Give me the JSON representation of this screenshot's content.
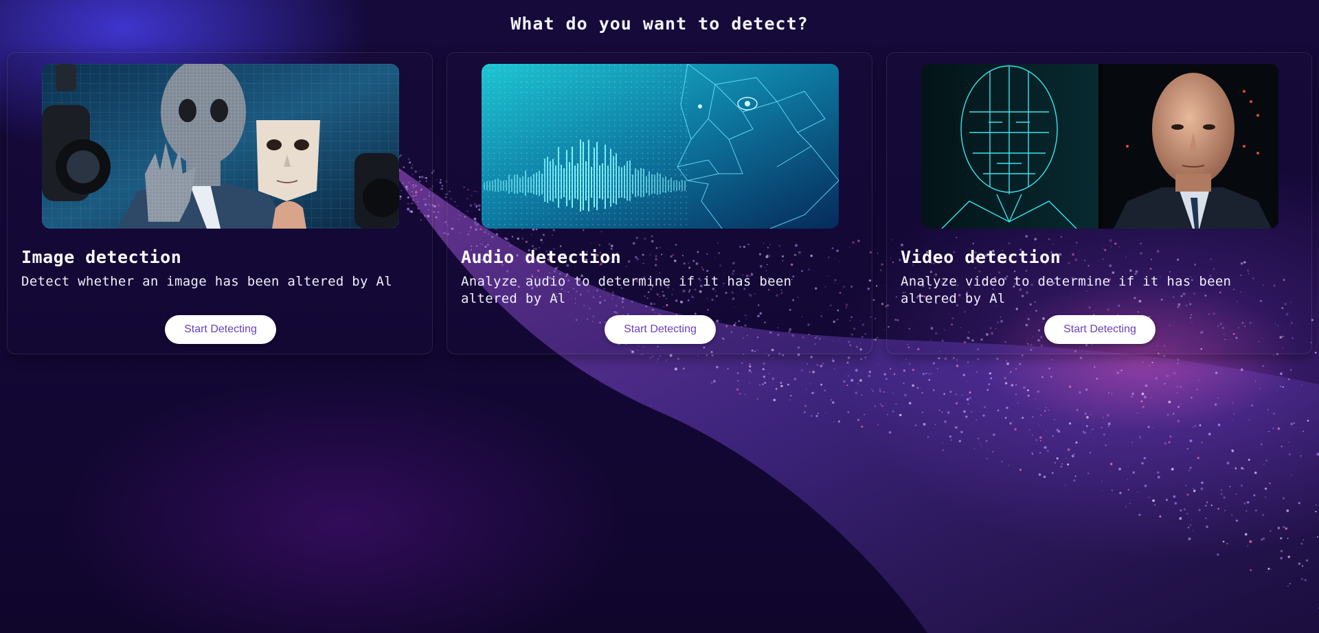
{
  "header": {
    "title": "What do you want to detect?"
  },
  "cards": [
    {
      "title": "Image detection",
      "description": "Detect whether an image has been altered by Al",
      "button_label": "Start Detecting",
      "image_icon": "masked-face-image"
    },
    {
      "title": "Audio detection",
      "description": "Analyze audio to determine if it has been altered by Al",
      "button_label": "Start Detecting",
      "image_icon": "audio-waveform-face-image"
    },
    {
      "title": "Video detection",
      "description": "Analyze video to determine if it has been altered by Al",
      "button_label": "Start Detecting",
      "image_icon": "wireframe-and-real-face-image"
    }
  ],
  "colors": {
    "background": "#140838",
    "accent": "#6a3fbf",
    "particles": "#b070ff"
  }
}
